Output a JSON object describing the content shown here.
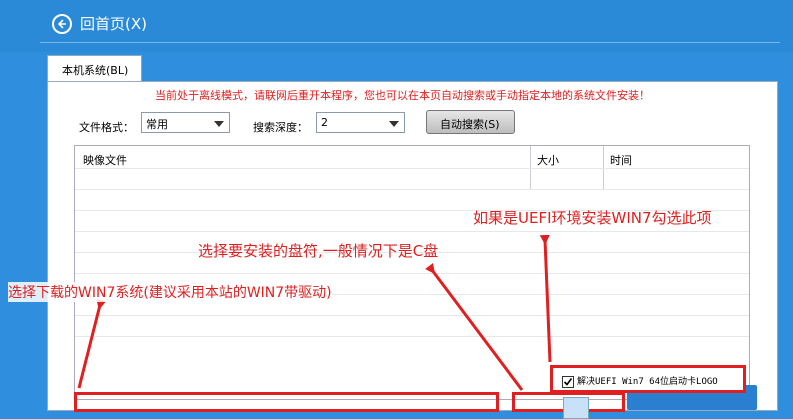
{
  "header": {
    "back_label": "回首页(X)"
  },
  "tabs": [
    {
      "label": "本机系统(BL)"
    }
  ],
  "notice": "当前处于离线模式，请联网后重开本程序，您也可以在本页自动搜索或手动指定本地的系统文件安装！",
  "filters": {
    "format_label": "文件格式：",
    "format_value": "常用",
    "depth_label": "搜索深度：",
    "depth_value": "2",
    "auto_search_label": "自动搜索(S)"
  },
  "table": {
    "columns": [
      "映像文件",
      "大小",
      "时间"
    ]
  },
  "uefi_checkbox": {
    "label": "解决UEFI Win7 64位启动卡LOGO",
    "checked": true
  },
  "annotations": {
    "uefi_hint": "如果是UEFI环境安装WIN7勾选此项",
    "disk_hint": "选择要安装的盘符,一般情况下是C盘",
    "file_hint": "选择下载的WIN7系统(建议采用本站的WIN7带驱动)"
  },
  "colors": {
    "header_bg": "#2b8ad8",
    "annotation_red": "#e02020"
  }
}
